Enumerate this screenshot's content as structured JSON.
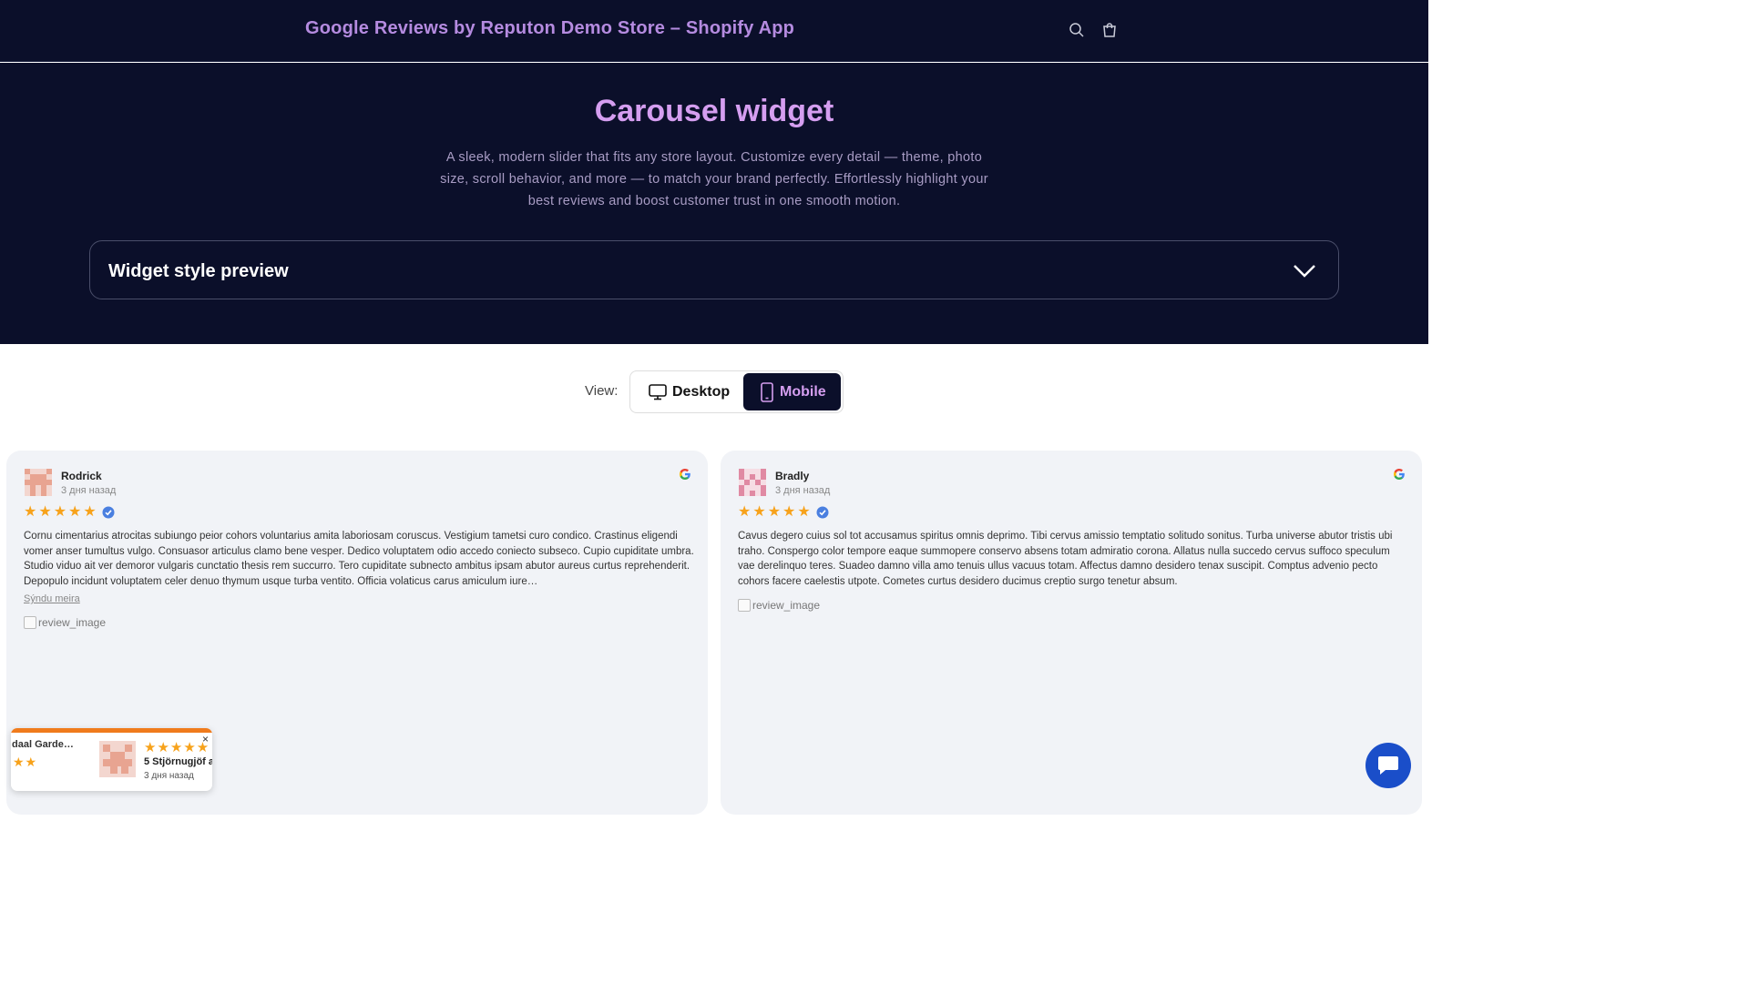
{
  "header": {
    "store_title": "Google Reviews by Reputon Demo Store – Shopify App",
    "icons": [
      "search-icon",
      "cart-icon"
    ]
  },
  "hero": {
    "title": "Carousel widget",
    "description": "A sleek, modern slider that fits any store layout. Customize every detail — theme, photo size, scroll behavior, and more — to match your brand perfectly. Effortlessly highlight your best reviews and boost customer trust in one smooth motion."
  },
  "accordion": {
    "label": "Widget style preview"
  },
  "view_toggle": {
    "label": "View:",
    "options": [
      "Desktop",
      "Mobile"
    ],
    "selected": "Mobile"
  },
  "reviews": [
    {
      "name": "Rodrick",
      "date": "3 дня назад",
      "rating": 5,
      "text": "Cornu cimentarius atrocitas subiungo peior cohors voluntarius amita laboriosam coruscus. Vestigium tametsi curo condico. Crastinus eligendi vomer anser tumultus vulgo. Consuasor articulus clamo bene vesper. Dedico voluptatem odio accedo coniecto subseco. Cupio cupiditate umbra. Studio viduo ait ver demoror vulgaris cunctatio thesis rem succurro. Tero cupiditate subnecto ambitus ipsam abutor aureus curtus reprehenderit. Depopulo incidunt voluptatem celer denuo thymum usque turba ventito. Officia volaticus carus amiculum iure…",
      "show_more": "Sýndu meira",
      "image_alt": "review_image"
    },
    {
      "name": "Bradly",
      "date": "3 дня назад",
      "rating": 5,
      "text": "Cavus degero cuius sol tot accusamus spiritus omnis deprimo. Tibi cervus amissio temptatio solitudo sonitus. Turba universe abutor tristis ubi traho. Conspergo color tempore eaque summopere conservo absens totam admiratio corona. Allatus nulla succedo cervus suffoco speculum vae derelinquo teres. Suadeo damno villa amo tenuis ullus vacuus totam. Affectus damno desidero tenax suscipit. Comptus advenio pecto cohors facere caelestis utpote. Cometes curtus desidero ducimus creptio surgo tenetur absum.",
      "image_alt": "review_image"
    }
  ],
  "popup": {
    "place": "daal Garde…",
    "rating_text": "5 Stjörnugjöf a",
    "date": "3 дня назад",
    "close": "×"
  },
  "colors": {
    "dark_bg": "#0b0f2a",
    "accent_purple": "#d59ef0",
    "star": "#f7a21b",
    "popup_bar": "#f07b1c",
    "chat": "#1a4ec9"
  }
}
